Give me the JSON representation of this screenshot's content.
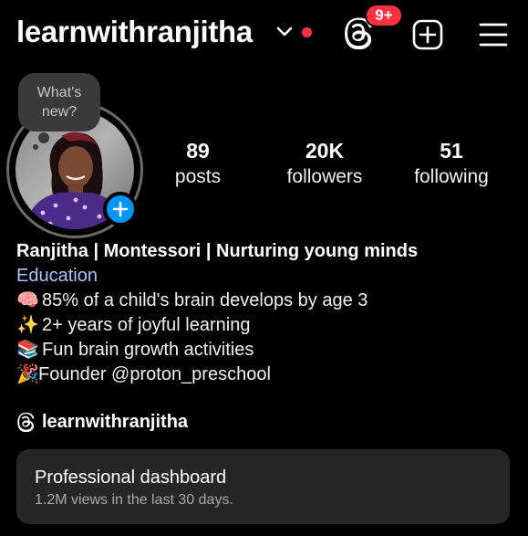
{
  "colors": {
    "background": "#000000",
    "accent_red": "#ff3040",
    "accent_blue": "#0095f6",
    "category_link": "#a8c7fa",
    "card": "#262626"
  },
  "header": {
    "username": "learnwithranjitha",
    "notification_badge": "9+",
    "icons": [
      "chevron-down-icon",
      "threads-icon",
      "add-content-icon",
      "menu-icon"
    ]
  },
  "profile": {
    "note_text": "What's new?"
  },
  "stats": [
    {
      "value": "89",
      "label": "posts"
    },
    {
      "value": "20K",
      "label": "followers"
    },
    {
      "value": "51",
      "label": "following"
    }
  ],
  "bio": {
    "name": "Ranjitha | Montessori | Nurturing young minds",
    "category": "Education",
    "lines": [
      {
        "emoji": "🧠",
        "text": "85% of a child's brain develops by age 3"
      },
      {
        "emoji": "✨",
        "text": "2+ years of joyful learning"
      },
      {
        "emoji": "📚",
        "text": "Fun brain growth activities"
      },
      {
        "emoji": "🎉",
        "text": "Founder @proton_preschool"
      }
    ]
  },
  "threads_link": {
    "handle": "learnwithranjitha"
  },
  "dashboard": {
    "title": "Professional dashboard",
    "subtitle": "1.2M views in the last 30 days."
  }
}
